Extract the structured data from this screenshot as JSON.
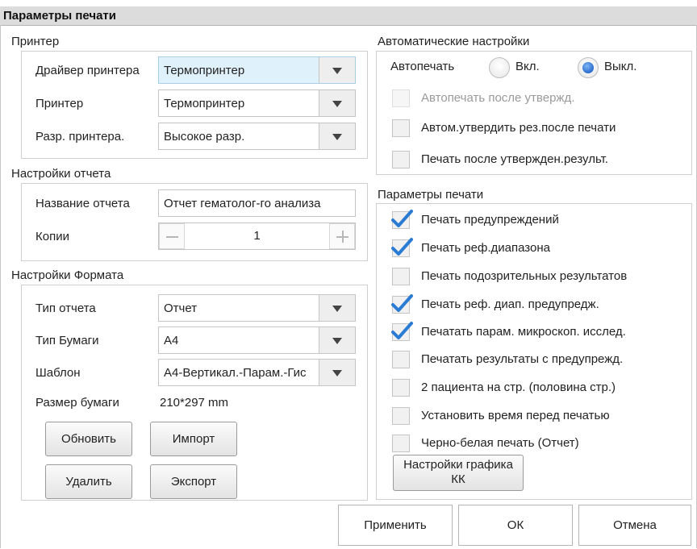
{
  "window_title": "Параметры печати",
  "printer": {
    "title": "Принтер",
    "driver_label": "Драйвер принтера",
    "driver_value": "Термопринтер",
    "printer_label": "Принтер",
    "printer_value": "Термопринтер",
    "resolution_label": "Разр. принтера.",
    "resolution_value": "Высокое разр."
  },
  "report": {
    "title": "Настройки отчета",
    "name_label": "Название отчета",
    "name_value": "Отчет гематолог-го анализа",
    "copies_label": "Копии",
    "copies_value": "1",
    "minus": "—",
    "plus": "+"
  },
  "format": {
    "title": "Настройки Формата",
    "report_type_label": "Тип отчета",
    "report_type_value": "Отчет",
    "paper_type_label": "Тип Бумаги",
    "paper_type_value": "А4",
    "template_label": "Шаблон",
    "template_value": "А4-Вертикал.-Парам.-Гис",
    "paper_size_label": "Размер бумаги",
    "paper_size_value": "210*297 mm",
    "update_button": "Обновить",
    "import_button": "Импорт",
    "delete_button": "Удалить",
    "export_button": "Экспорт"
  },
  "auto": {
    "title": "Автоматические настройки",
    "autoprint_label": "Автопечать",
    "on_label": "Вкл.",
    "off_label": "Выкл.",
    "selected": "off",
    "options": [
      {
        "label": "Автопечать после утвержд.",
        "checked": false,
        "disabled": true
      },
      {
        "label": "Автом.утвердить рез.после печати",
        "checked": false,
        "disabled": false
      },
      {
        "label": "Печать после утвержден.результ.",
        "checked": false,
        "disabled": false
      }
    ]
  },
  "print_params": {
    "title": "Параметры печати",
    "options": [
      {
        "label": "Печать предупреждений",
        "checked": true
      },
      {
        "label": "Печать реф.диапазона",
        "checked": true
      },
      {
        "label": "Печать подозрительных результатов",
        "checked": false
      },
      {
        "label": "Печать реф. диап. предупредж.",
        "checked": true
      },
      {
        "label": "Печатать парам. микроскоп. исслед.",
        "checked": true
      },
      {
        "label": "Печатать результаты с предупрежд.",
        "checked": false
      },
      {
        "label": "2 пациента на стр. (половина стр.)",
        "checked": false
      },
      {
        "label": "Установить время перед печатью",
        "checked": false
      },
      {
        "label": "Черно-белая печать (Отчет)",
        "checked": false
      }
    ],
    "qc_button_line1": "Настройки графика",
    "qc_button_line2": "КК"
  },
  "footer": {
    "apply": "Применить",
    "ok": "ОК",
    "cancel": "Отмена"
  },
  "colors": {
    "check_blue": "#2a7bd3",
    "radio_blue": "#1f63c9",
    "selected_combo": "#dff1fb"
  }
}
